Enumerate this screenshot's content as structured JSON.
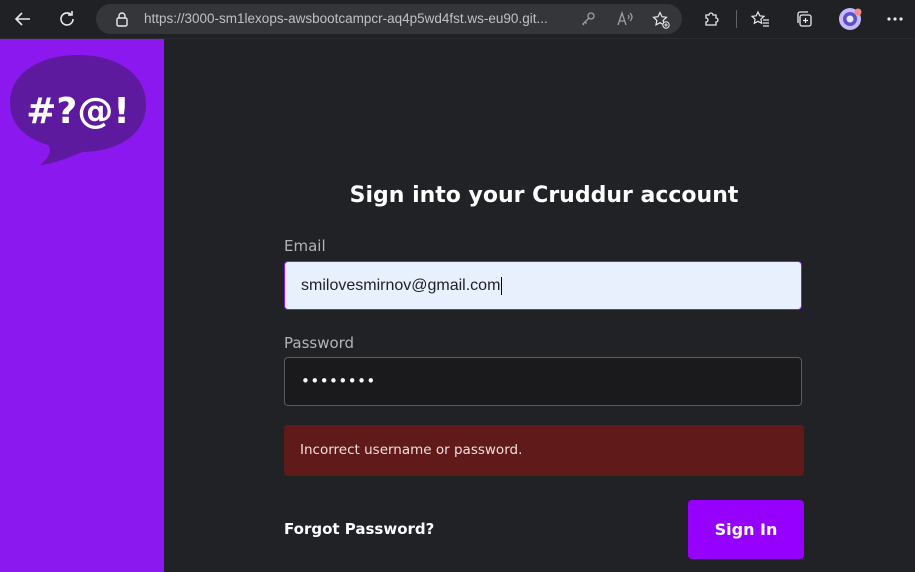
{
  "browser": {
    "url": "https://3000-sm1lexops-awsbootcampcr-aq4p5wd4fst.ws-eu90.git...",
    "icons": [
      "back-icon",
      "refresh-icon",
      "lock-icon",
      "key-icon",
      "read-aloud-icon",
      "add-favorite-icon",
      "extensions-icon",
      "favorites-icon",
      "collections-icon",
      "profile-icon",
      "more-icon"
    ]
  },
  "sidebar": {
    "logo_text": "#?@!",
    "colors": {
      "background": "#8a18ef",
      "bubble": "#5e1a9e"
    }
  },
  "form": {
    "title": "Sign into your Cruddur account",
    "email_label": "Email",
    "email_value": "smilovesmirnov@gmail.com",
    "password_label": "Password",
    "password_value": "••••••••",
    "error_message": "Incorrect username or password.",
    "forgot_link": "Forgot Password?",
    "submit_label": "Sign In"
  },
  "colors": {
    "accent": "#9500ff",
    "error_bg": "#611a1a",
    "main_bg": "#212226"
  }
}
